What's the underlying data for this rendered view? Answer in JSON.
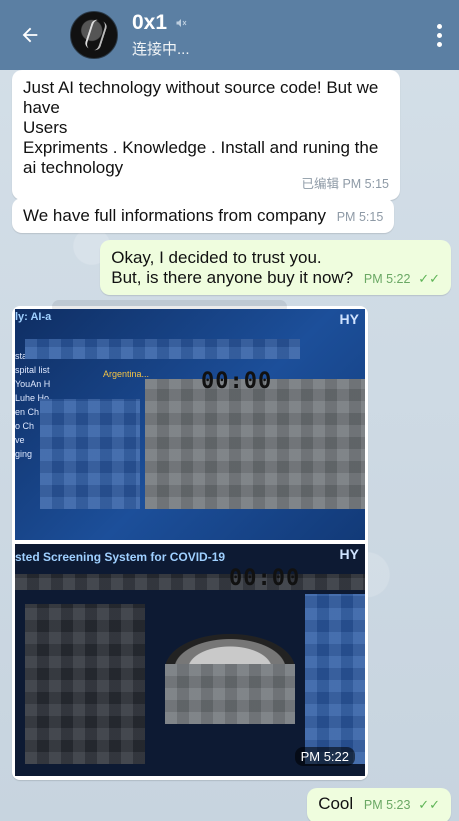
{
  "header": {
    "title": "0x1",
    "status": "连接中...",
    "back_icon": "arrow-left-icon",
    "mute_icon": "muted-speaker-icon",
    "menu_icon": "more-vertical-icon"
  },
  "messages": [
    {
      "direction": "in",
      "lines": [
        "Just AI technology without source code! But we have",
        "Users",
        "Expriments . Knowledge . Install and runing the ai technology"
      ],
      "edited": "已编辑",
      "time": "PM 5:15"
    },
    {
      "direction": "in",
      "text": "We have full informations from company",
      "time": "PM 5:15"
    },
    {
      "direction": "out",
      "lines": [
        "Okay, I decided to trust you.",
        "But, is there anyone buy it now?"
      ],
      "time": "PM 5:22",
      "read": "✓✓"
    },
    {
      "direction": "in",
      "type": "media-album",
      "images": [
        {
          "caption": "ly: AI-a",
          "country": "Argentina...",
          "sidebar": [
            "sta",
            "spital list",
            "YouAn H",
            "Luhe Ho",
            "en Ch",
            "o Ch",
            "ve",
            "ging"
          ],
          "timer": "00:00",
          "logo": "HY"
        },
        {
          "caption": "sted Screening System for COVID-19",
          "timer": "00:00",
          "logo": "HY"
        }
      ],
      "time": "PM 5:22"
    },
    {
      "direction": "out",
      "text": "Cool",
      "time": "PM 5:23",
      "read": "✓✓"
    }
  ],
  "colors": {
    "header_bg": "#5b7fa3",
    "incoming_bubble": "#ffffff",
    "outgoing_bubble": "#effdde",
    "read_check": "#5fb457"
  }
}
